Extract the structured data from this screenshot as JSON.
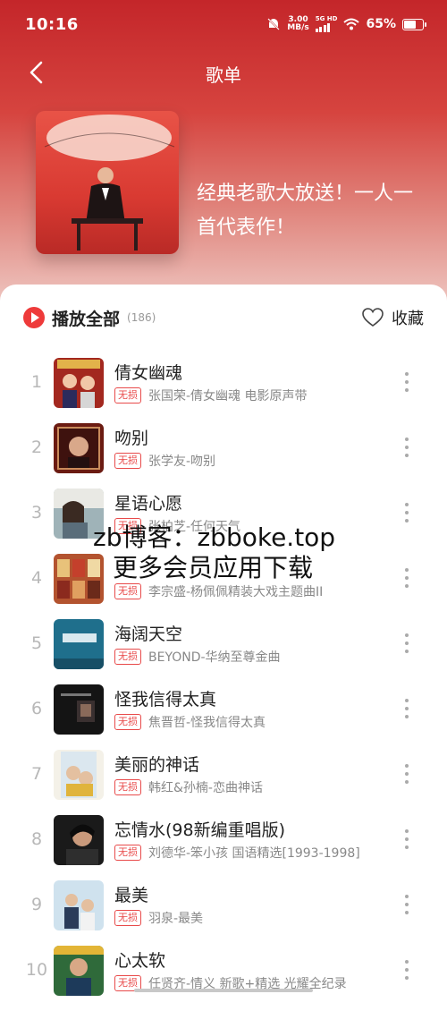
{
  "status_bar": {
    "time": "10:16",
    "net_speed_value": "3.00",
    "net_speed_unit": "MB/s",
    "signal_label": "5G HD",
    "battery_percent": "65%"
  },
  "header": {
    "title": "歌单",
    "description": "经典老歌大放送！一人一首代表作！"
  },
  "toolbar": {
    "play_all_label": "播放全部",
    "song_count": "(186)",
    "collect_label": "收藏"
  },
  "songs": [
    {
      "index": "1",
      "title": "倩女幽魂",
      "tag": "无损",
      "subtitle": "张国荣-倩女幽魂 电影原声带"
    },
    {
      "index": "2",
      "title": "吻别",
      "tag": "无损",
      "subtitle": "张学友-吻别"
    },
    {
      "index": "3",
      "title": "星语心愿",
      "tag": "无损",
      "subtitle": "张柏芝-任何天气"
    },
    {
      "index": "4",
      "title": "",
      "tag": "无损",
      "subtitle": "李宗盛-杨佩佩精装大戏主题曲II"
    },
    {
      "index": "5",
      "title": "海阔天空",
      "tag": "无损",
      "subtitle": "BEYOND-华纳至尊金曲"
    },
    {
      "index": "6",
      "title": "怪我信得太真",
      "tag": "无损",
      "subtitle": "焦晋哲-怪我信得太真"
    },
    {
      "index": "7",
      "title": "美丽的神话",
      "tag": "无损",
      "subtitle": "韩红&孙楠-恋曲神话"
    },
    {
      "index": "8",
      "title": "忘情水(98新编重唱版)",
      "tag": "无损",
      "subtitle": "刘德华-笨小孩 国语精选[1993-1998]"
    },
    {
      "index": "9",
      "title": "最美",
      "tag": "无损",
      "subtitle": "羽泉-最美"
    },
    {
      "index": "10",
      "title": "心太软",
      "tag": "无损",
      "subtitle": "任贤齐-情义 新歌+精选 光耀全纪录"
    }
  ],
  "watermark": {
    "line1": "zb博客：zbboke.top",
    "line2": "更多会员应用下载"
  },
  "colors": {
    "accent": "#ee3a3a",
    "header_top": "#c4262a",
    "tag_red": "#e84a4a"
  }
}
